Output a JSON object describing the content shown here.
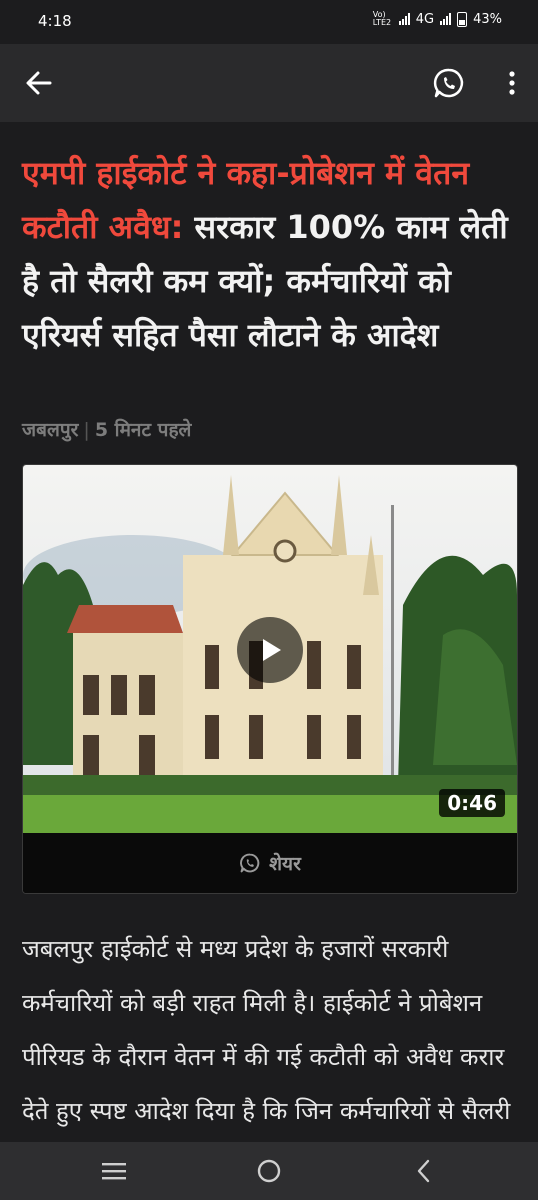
{
  "status": {
    "time": "4:18",
    "carrier": "Vo) LTE2",
    "network": "4G",
    "battery": "43%"
  },
  "app_bar": {
    "back_icon": "arrow-left-icon",
    "whatsapp_icon": "whatsapp-icon",
    "more_icon": "more-vertical-icon"
  },
  "article": {
    "headline_highlight": "एमपी हाईकोर्ट ने कहा-प्रोबेशन में वेतन कटौती अवैध:",
    "headline_rest": " सरकार 100% काम लेती है तो सैलरी कम क्यों; कर्मचारियों को एरियर्स सहित पैसा लौटाने के आदेश",
    "location": "जबलपुर",
    "time_ago": "5 मिनट पहले",
    "video": {
      "duration": "0:46",
      "share_label": "शेयर"
    },
    "body": "जबलपुर हाईकोर्ट से मध्य प्रदेश के हजारों सरकारी कर्मचारियों को बड़ी राहत मिली है। हाईकोर्ट ने प्रोबेशन पीरियड के दौरान वेतन में की गई कटौती को अवैध करार देते हुए स्पष्ट आदेश दिया है कि जिन कर्मचारियों से सैलरी"
  },
  "colors": {
    "headline_accent": "#f0493c",
    "background": "#1c1c1e",
    "app_bar": "#2a2a2c"
  },
  "nav": {
    "recents_icon": "recents-icon",
    "home_icon": "home-circle-icon",
    "back_icon": "back-chevron-icon"
  }
}
